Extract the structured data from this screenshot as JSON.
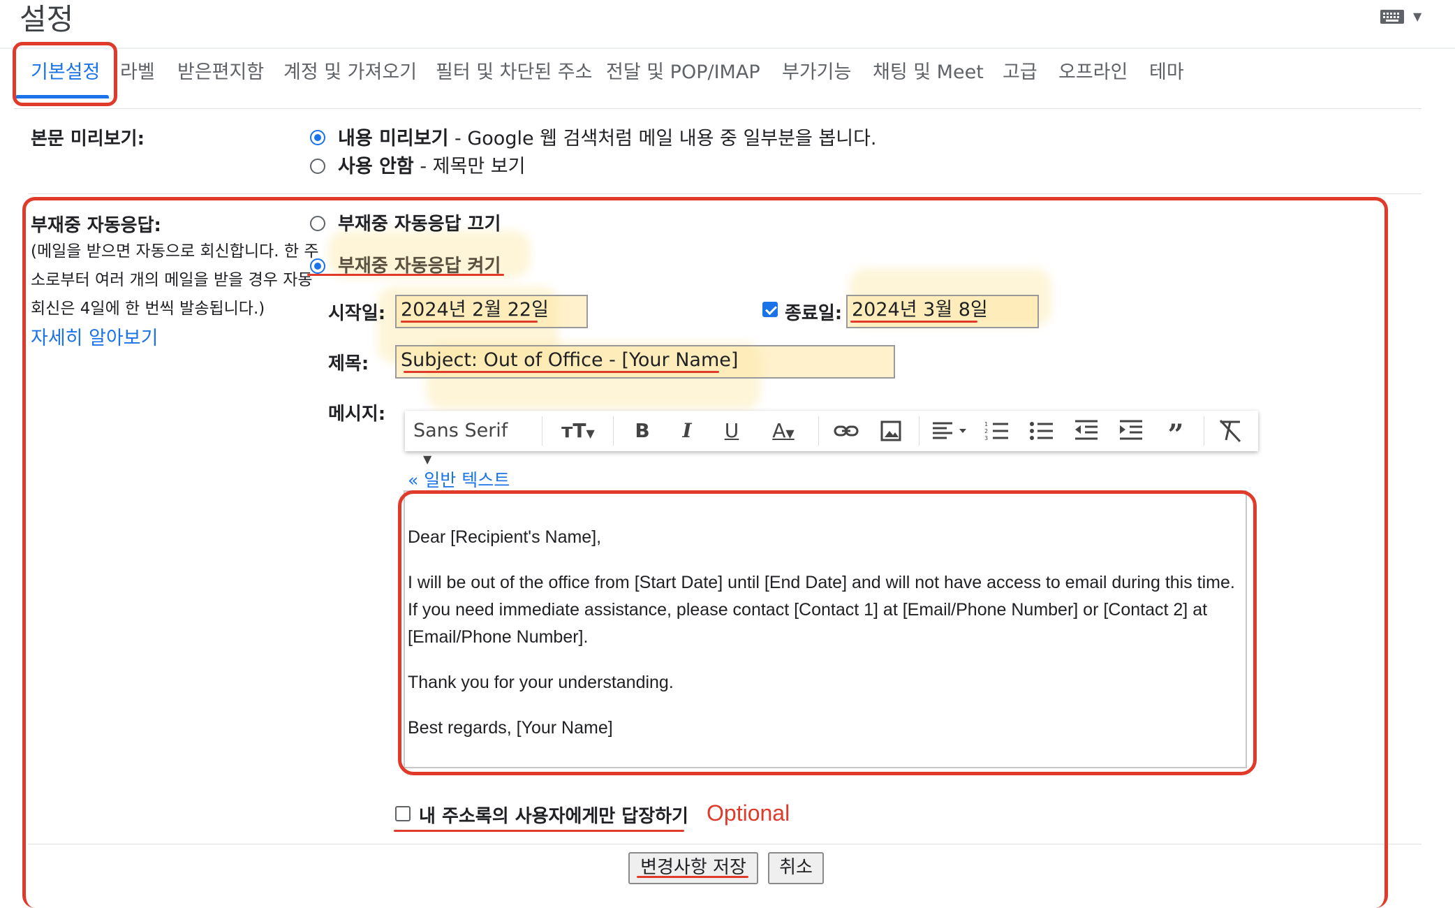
{
  "header": {
    "title": "설정"
  },
  "tabs": [
    "기본설정",
    "라벨",
    "받은편지함",
    "계정 및 가져오기",
    "필터 및 차단된 주소",
    "전달 및 POP/IMAP",
    "부가기능",
    "채팅 및 Meet",
    "고급",
    "오프라인",
    "테마"
  ],
  "preview": {
    "label": "본문 미리보기:",
    "option1_bold": "내용 미리보기",
    "option1_desc": " - Google 웹 검색처럼 메일 내용 중 일부분을 봅니다.",
    "option2_bold": "사용 안함",
    "option2_desc": " - 제목만 보기"
  },
  "vacation": {
    "label": "부재중 자동응답:",
    "desc_line1": "(메일을 받으면 자동으로 회신합니다. 한 주",
    "desc_line2": "소로부터 여러 개의 메일을 받을 경우 자동",
    "desc_line3": "회신은 4일에 한 번씩 발송됩니다.)",
    "learn_more": "자세히 알아보기",
    "off_label": "부재중 자동응답 끄기",
    "on_label": "부재중 자동응답 켜기",
    "start_label": "시작일:",
    "start_value": "2024년 2월 22일",
    "end_label": "종료일:",
    "end_value": "2024년 3월 8일",
    "subject_label": "제목:",
    "subject_value": "Subject: Out of Office - [Your Name]",
    "message_label": "메시지:",
    "plain_text_link": "« 일반 텍스트",
    "message_lines": [
      "Dear [Recipient's Name],",
      "I will be out of the office from [Start Date] until [End Date] and will not have access to email during this time. If you need immediate assistance, please contact [Contact 1] at [Email/Phone Number] or [Contact 2] at [Email/Phone Number].",
      "Thank you for your understanding.",
      "Best regards, [Your Name]"
    ],
    "contacts_only_label": "내 주소록의 사용자에게만 답장하기",
    "optional_note": "Optional"
  },
  "toolbar": {
    "font": "Sans Serif",
    "icons": [
      "text-size-icon",
      "bold-icon",
      "italic-icon",
      "underline-icon",
      "text-color-icon",
      "link-icon",
      "image-icon",
      "align-icon",
      "numbered-list-icon",
      "bulleted-list-icon",
      "indent-less-icon",
      "indent-more-icon",
      "quote-icon",
      "remove-formatting-icon"
    ]
  },
  "footer": {
    "save_label": "변경사항 저장",
    "cancel_label": "취소"
  },
  "colors": {
    "accent": "#1a73e8",
    "annotation": "#e03a2a",
    "highlight": "#fde6a0"
  }
}
